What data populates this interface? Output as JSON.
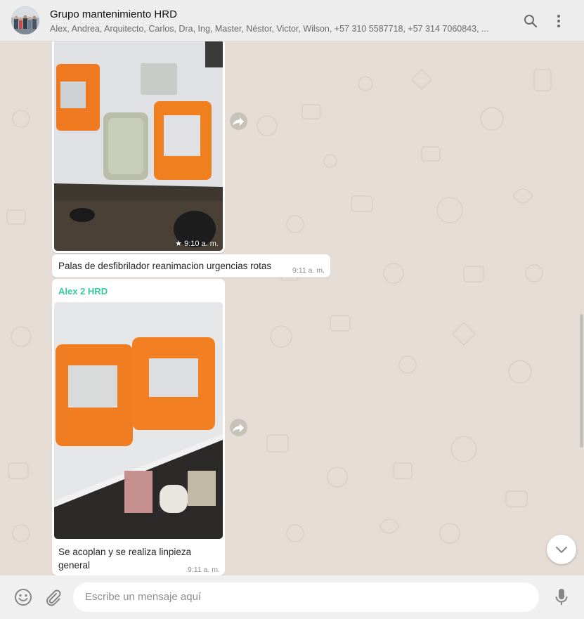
{
  "header": {
    "title": "Grupo mantenimiento HRD",
    "participants": "Alex, Andrea, Arquitecto, Carlos, Dra, Ing, Master, Néstor, Victor, Wilson, +57 310 5587718, +57 314 7060843, ...",
    "icons": [
      "search-icon",
      "menu-icon"
    ]
  },
  "messages": [
    {
      "type": "image",
      "time": "9:10 a. m.",
      "starred": true,
      "icon": "star-icon"
    },
    {
      "type": "text",
      "text": "Palas de desfibrilador reanimacion urgencias rotas",
      "time": "9:11 a. m."
    },
    {
      "type": "image-caption",
      "sender": "Alex 2 HRD",
      "caption_line1": "Se acoplan y se realiza linpieza",
      "caption_line2": "general",
      "time": "9:11 a. m."
    }
  ],
  "footer": {
    "placeholder": "Escribe un mensaje aquí",
    "icons": [
      "emoji-icon",
      "attach-icon",
      "mic-icon"
    ]
  },
  "colors": {
    "background": "#e5ddd5",
    "header": "#ededed",
    "sender": "#35cd96",
    "footer": "#f0f0f0"
  }
}
